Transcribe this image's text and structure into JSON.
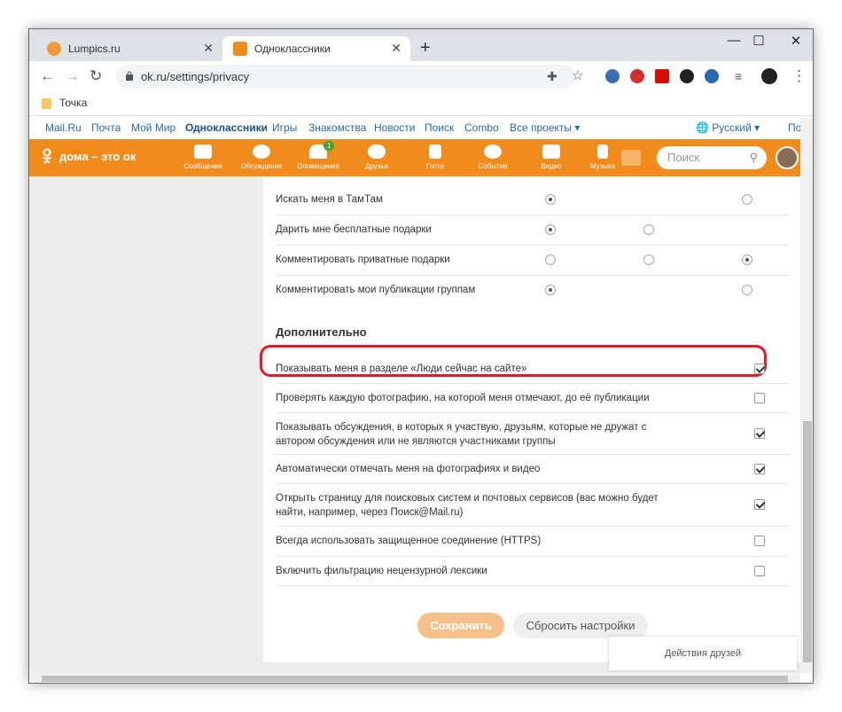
{
  "browser": {
    "tabs": [
      {
        "title": "Lumpics.ru"
      },
      {
        "title": "Одноклассники"
      }
    ],
    "address": "ok.ru/settings/privacy",
    "bookmark": "Точка"
  },
  "portal": {
    "links": [
      "Mail.Ru",
      "Почта",
      "Мой Мир",
      "Одноклассники",
      "Игры",
      "Знакомства",
      "Новости",
      "Поиск",
      "Combo",
      "Все проекты"
    ],
    "language": "Русский",
    "help": "Помо"
  },
  "ok": {
    "logo": "дома – это ок",
    "nav": [
      {
        "label": "Сообщения"
      },
      {
        "label": "Обсуждения"
      },
      {
        "label": "Оповещения",
        "badge": "1"
      },
      {
        "label": "Друзья"
      },
      {
        "label": "Гости"
      },
      {
        "label": "События"
      },
      {
        "label": "Видео"
      },
      {
        "label": "Музыка"
      }
    ],
    "search_placeholder": "Поиск",
    "brand_color": "#f18b1b"
  },
  "settings": {
    "radio_rows": [
      {
        "label": "Искать меня в ТамТам",
        "opts": [
          1,
          null,
          0
        ]
      },
      {
        "label": "Дарить мне бесплатные подарки",
        "opts": [
          1,
          0,
          null
        ]
      },
      {
        "label": "Комментировать приватные подарки",
        "opts": [
          0,
          0,
          1
        ]
      },
      {
        "label": "Комментировать мои публикации группам",
        "opts": [
          1,
          null,
          0
        ]
      }
    ],
    "section_title": "Дополнительно",
    "checkbox_rows": [
      {
        "label": "Показывать меня в разделе «Люди сейчас на сайте»",
        "checked": true,
        "highlighted": true
      },
      {
        "label": "Проверять каждую фотографию, на которой меня отмечают, до её публикации",
        "checked": false
      },
      {
        "label": "Показывать обсуждения, в которых я участвую, друзьям, которые не дружат с автором обсуждения или не являются участниками группы",
        "checked": true
      },
      {
        "label": "Автоматически отмечать меня на фотографиях и видео",
        "checked": true
      },
      {
        "label": "Открыть страницу для поисковых систем и почтовых сервисов (вас можно будет найти, например, через Поиск@Mail.ru)",
        "checked": true
      },
      {
        "label": "Всегда использовать защищенное соединение (HTTPS)",
        "checked": false
      },
      {
        "label": "Включить фильтрацию нецензурной лексики",
        "checked": false
      }
    ],
    "save_label": "Сохранить",
    "reset_label": "Сбросить настройки",
    "highlight_color": "#e6192b"
  },
  "friends_widget": "Действия друзей"
}
